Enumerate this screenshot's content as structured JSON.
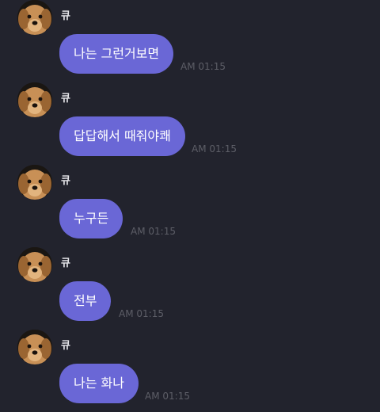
{
  "chat": {
    "messages": [
      {
        "sender": "큐",
        "text": "나는 그런거보면",
        "time": "AM 01:15"
      },
      {
        "sender": "큐",
        "text": "답답해서 때줘야쾌",
        "time": "AM 01:15"
      },
      {
        "sender": "큐",
        "text": "누구든",
        "time": "AM 01:15"
      },
      {
        "sender": "큐",
        "text": "전부",
        "time": "AM 01:15"
      },
      {
        "sender": "큐",
        "text": "나는 화나",
        "time": "AM 01:15"
      }
    ]
  },
  "colors": {
    "background": "#22232d",
    "bubble": "#6a67d6",
    "bubble_text": "#ffffff",
    "sender_text": "#e6e6ea",
    "time_text": "#5d5e67"
  },
  "icons": {
    "avatar": "dog-avatar-icon"
  }
}
